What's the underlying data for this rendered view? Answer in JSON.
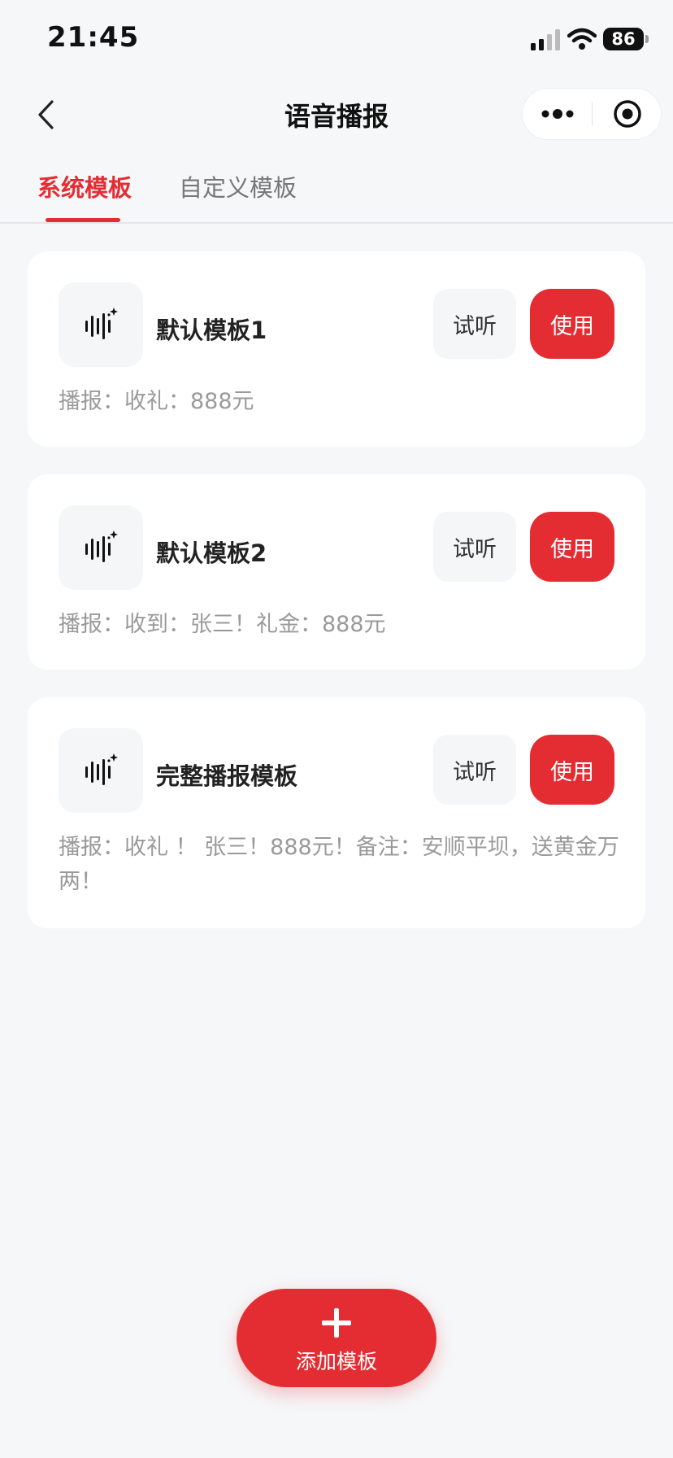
{
  "status_bar": {
    "time": "21:45",
    "battery": "86"
  },
  "nav": {
    "title": "语音播报"
  },
  "tabs": [
    {
      "label": "系统模板",
      "active": true
    },
    {
      "label": "自定义模板",
      "active": false
    }
  ],
  "templates": [
    {
      "name": "默认模板1",
      "preview_label": "试听",
      "use_label": "使用",
      "description": "播报：收礼：888元"
    },
    {
      "name": "默认模板2",
      "preview_label": "试听",
      "use_label": "使用",
      "description": "播报：收到：张三！礼金：888元"
    },
    {
      "name": "完整播报模板",
      "preview_label": "试听",
      "use_label": "使用",
      "description": "播报：收礼 ！ 张三！888元！备注：安顺平坝，送黄金万两！"
    }
  ],
  "add_button": {
    "label": "添加模板"
  },
  "icons": {
    "back": "chevron-left-icon",
    "more": "more-dots-icon",
    "close": "target-circle-icon",
    "template": "voice-wave-sparkle-icon",
    "add": "plus-icon"
  },
  "colors": {
    "accent": "#e42d33",
    "background": "#f6f7f9",
    "card": "#ffffff",
    "muted_text": "#9a9a9a"
  }
}
